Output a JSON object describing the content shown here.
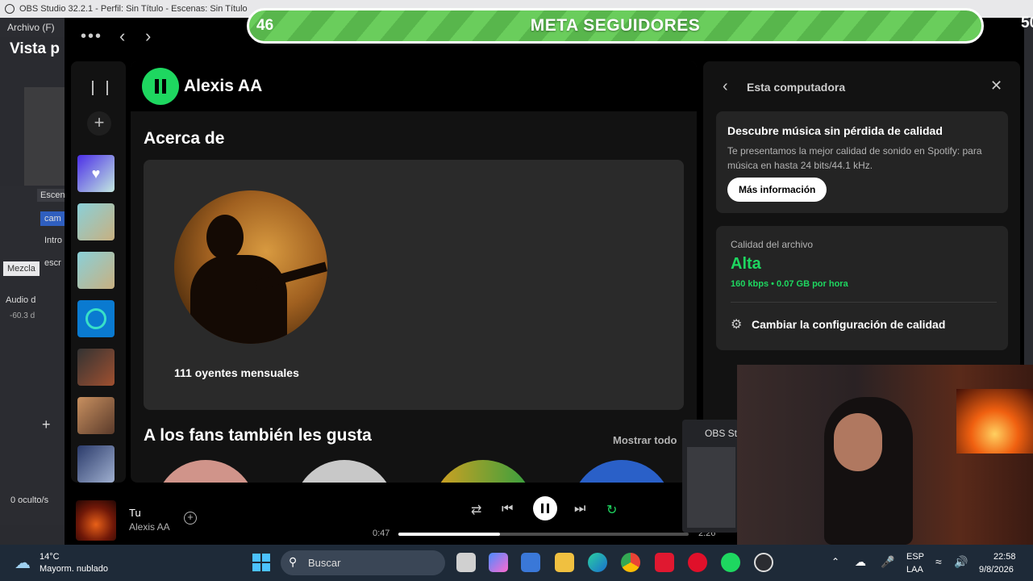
{
  "obs": {
    "window_title": "OBS Studio 32.2.1 - Perfil: Sin Título - Escenas: Sin Título",
    "menu_archivo": "Archivo (F)",
    "vista_previa": "Vista p",
    "scene_tab": "Escen",
    "scene_item_1": "cam",
    "scene_item_2": "Intro",
    "scene_item_3": "escr",
    "mixer_tab": "Mezcla",
    "audio_label": "Audio d",
    "audio_db": "-60.3 d",
    "hidden_count": "0 oculto/s",
    "obs_thumb_label": "OBS St"
  },
  "goal": {
    "title": "META SEGUIDORES",
    "start": "46",
    "end": "50",
    "fill_fraction": 1.0
  },
  "spotify": {
    "artist_name": "Alexis AA",
    "about_heading": "Acerca de",
    "monthly_listeners": "111 oyentes mensuales",
    "fans_heading": "A los fans también les gusta",
    "show_all": "Mostrar todo",
    "right_panel": {
      "title": "Esta computadora",
      "promo_title": "Descubre música sin pérdida de calidad",
      "promo_body": "Te presentamos la mejor calidad de sonido en Spotify: para música en hasta 24 bits/44.1 kHz.",
      "promo_button": "Más información",
      "file_quality_label": "Calidad del archivo",
      "file_quality_value": "Alta",
      "file_quality_detail": "160 kbps • 0.07 GB por hora",
      "change_quality": "Cambiar la configuración de calidad"
    },
    "player": {
      "track_title": "Tu",
      "track_artist": "Alexis AA",
      "elapsed": "0:47",
      "duration": "2:26",
      "progress_fraction": 0.35
    }
  },
  "taskbar": {
    "weather_temp": "14°C",
    "weather_desc": "Mayorm. nublado",
    "search_placeholder": "Buscar",
    "language": "ESP",
    "layout": "LAA",
    "time": "22:58",
    "date": "9/8/2026"
  },
  "colors": {
    "spotify_green": "#1ed760",
    "goal_green": "#6acd5c"
  }
}
